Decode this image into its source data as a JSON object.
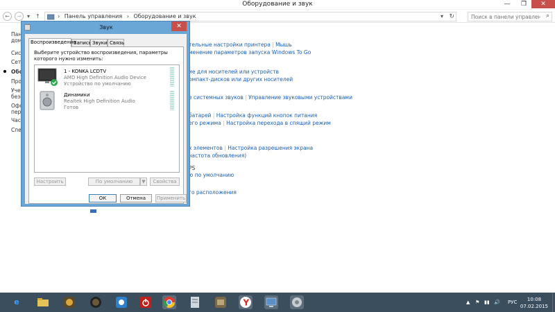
{
  "window": {
    "title": "Оборудование и звук",
    "min": "—",
    "max": "❐",
    "close": "✕"
  },
  "nav": {
    "back": "←",
    "forward": "→",
    "up": "↑",
    "breadcrumb": [
      "Панель управления",
      "›",
      "Оборудование и звук"
    ],
    "refresh": "↻",
    "search_placeholder": "Поиск в панели управления",
    "search_icon": "⌕"
  },
  "leftnav": {
    "items": [
      "Пане",
      "дома",
      "Сист",
      "Сети",
      "Обор",
      "Прог",
      "Учет",
      "безо",
      "Офо",
      "перс",
      "Часы",
      "Спец"
    ]
  },
  "content_links": {
    "r1": [
      "тельные настройки принтера",
      "|",
      "Мышь"
    ],
    "r2": "менение параметров запуска Windows To Go",
    "r3": "ие для носителей или устройств",
    "r4": "омпакт-дисков или других носителей",
    "r5": [
      "е системных звуков",
      "|",
      "Управление звуковыми устройствами"
    ],
    "r6": [
      "батарей",
      "|",
      "Настройка функций кнопок питания"
    ],
    "r7": [
      "его режима",
      "|",
      "Настройка перехода в спящий режим"
    ],
    "r8": [
      "х элементов",
      "|",
      "Настройка разрешения экрана"
    ],
    "r9": "частота обновления)",
    "r10": "PS",
    "r11": "ю по умолчанию",
    "r12": "го расположения"
  },
  "dialog": {
    "title": "Звук",
    "close": "✕",
    "tabs": [
      "Воспроизведение",
      "Запись",
      "Звуки",
      "Связь"
    ],
    "instruction": "Выберите устройство воспроизведения, параметры которого нужно изменить:",
    "devices": [
      {
        "name": "1 - KONKA LCDTV",
        "driver": "AMD High Definition Audio Device",
        "status": "Устройство по умолчанию"
      },
      {
        "name": "Динамики",
        "driver": "Realtek High Definition Audio",
        "status": "Готов"
      }
    ],
    "buttons": {
      "configure": "Настроить",
      "default": "По умолчанию",
      "default_arrow": "▼",
      "properties": "Свойства",
      "ok": "ОК",
      "cancel": "Отмена",
      "apply": "Применить"
    }
  },
  "taskbar": {
    "tray": {
      "flag": "⚑",
      "volume": "🔊",
      "lang": "РУС"
    },
    "time": "10:08",
    "date": "07.02.2015"
  }
}
